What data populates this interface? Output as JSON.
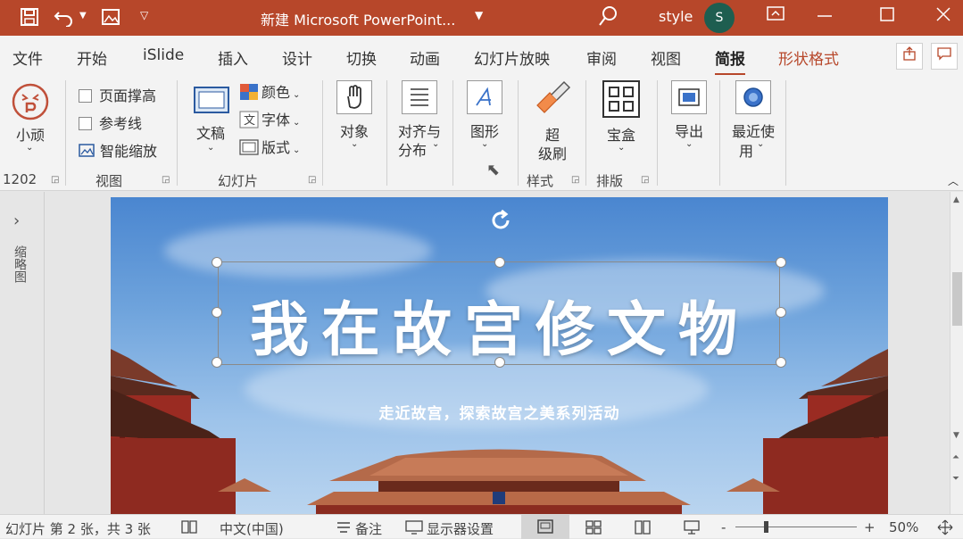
{
  "titlebar": {
    "title": "新建 Microsoft PowerPoint...",
    "user_name": "style",
    "avatar_letter": "S",
    "accent_color": "#b7472a"
  },
  "tabs": [
    "文件",
    "开始",
    "iSlide",
    "插入",
    "设计",
    "切换",
    "动画",
    "幻灯片放映",
    "审阅",
    "视图",
    "简报",
    "形状格式"
  ],
  "active_tab": "简报",
  "ribbon": {
    "xiaowan": "小顽",
    "count_label": "1202",
    "view_group": {
      "page_fit": "页面撑高",
      "guides": "参考线",
      "smart_zoom": "智能缩放",
      "label": "视图"
    },
    "slide_group": {
      "draft": "文稿",
      "color": "颜色",
      "font": "字体",
      "layout": "版式",
      "label": "幻灯片"
    },
    "object": "对象",
    "align_1": "对齐与",
    "align_2": "分布",
    "shape": "图形",
    "format_painter_1": "超",
    "format_painter_2": "级刷",
    "style_label": "样式",
    "treasure": "宝盒",
    "layout_label": "排版",
    "export": "导出",
    "recent_1": "最近使",
    "recent_2": "用"
  },
  "left_pane": {
    "label": "缩略图"
  },
  "slide": {
    "title": "我在故宫修文物",
    "subtitle": "走近故宫，探索故宫之美系列活动"
  },
  "statusbar": {
    "slide_info": "幻灯片 第 2 张，共 3 张",
    "language": "中文(中国)",
    "notes": "备注",
    "display": "显示器设置",
    "zoom_minus": "-",
    "zoom_plus": "+",
    "zoom": "50%"
  }
}
